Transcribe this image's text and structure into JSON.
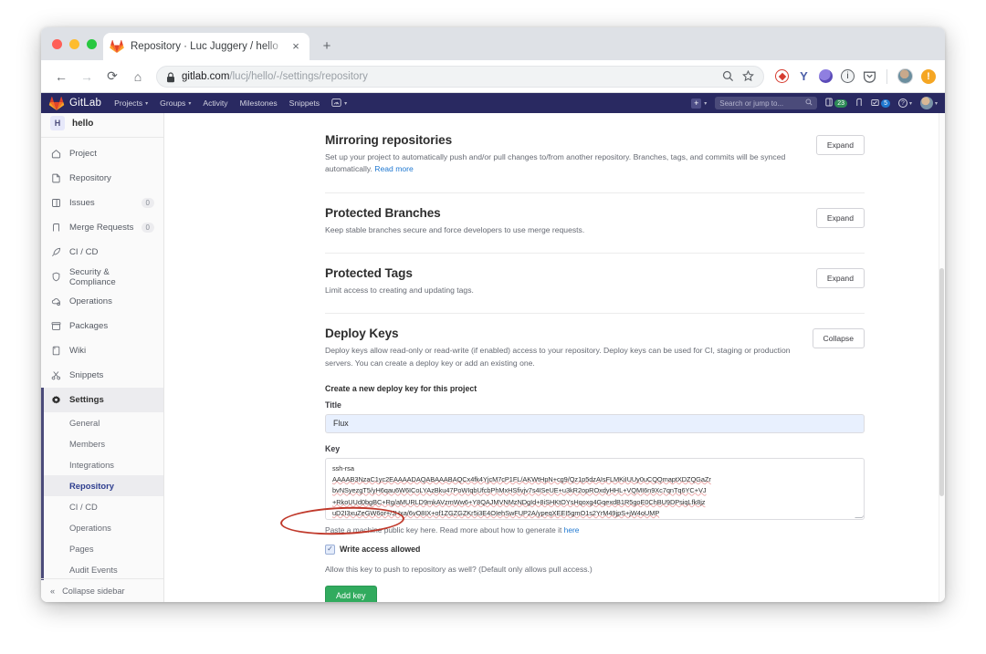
{
  "browser": {
    "tab": {
      "title": "Repository · Luc Juggery / hello",
      "favicon": "gitlab-fox-icon",
      "close": "×"
    },
    "new_tab_label": "+",
    "nav": {
      "back": "←",
      "forward": "→",
      "reload": "⟳",
      "home": "⌂"
    },
    "omnibox": {
      "lock": "lock-icon",
      "domain": "gitlab.com",
      "path": "/lucj/hello/-/settings/repository",
      "search_icon": "magnifier-icon",
      "star_icon": "star-icon"
    },
    "extensions": [
      {
        "name": "lastpass-extension-icon",
        "color": "#d63b2f"
      },
      {
        "name": "vimium-extension-icon",
        "color": "#4b5ea8"
      },
      {
        "name": "globe-extension-icon",
        "color": "#6f63c6"
      },
      {
        "name": "info-extension-icon",
        "color": "#5f6368"
      },
      {
        "name": "pocket-extension-icon",
        "color": "#5f6368"
      }
    ],
    "profile_warning": "!"
  },
  "gitlab": {
    "brand": "GitLab",
    "nav_items": [
      {
        "label": "Projects",
        "caret": true
      },
      {
        "label": "Groups",
        "caret": true
      },
      {
        "label": "Activity",
        "caret": false
      },
      {
        "label": "Milestones",
        "caret": false
      },
      {
        "label": "Snippets",
        "caret": false
      },
      {
        "label": "",
        "caret": true,
        "icon": "help-dashboard-icon"
      }
    ],
    "plus_label": "+",
    "search_placeholder": "Search or jump to...",
    "counters": [
      {
        "icon": "todo-icon",
        "count": "23",
        "color": "#2e8b57"
      },
      {
        "icon": "merge-requests-icon",
        "count": "",
        "color": ""
      },
      {
        "icon": "issues-icon",
        "count": "5",
        "color": "#1f78d1"
      }
    ],
    "help_label": "?",
    "project": {
      "initial": "H",
      "name": "hello"
    },
    "sidebar_items": [
      {
        "label": "Project",
        "icon": "home-icon",
        "count": ""
      },
      {
        "label": "Repository",
        "icon": "document-icon",
        "count": ""
      },
      {
        "label": "Issues",
        "icon": "issues-icon",
        "count": "0"
      },
      {
        "label": "Merge Requests",
        "icon": "merge-icon",
        "count": "0"
      },
      {
        "label": "CI / CD",
        "icon": "rocket-icon",
        "count": ""
      },
      {
        "label": "Security & Compliance",
        "icon": "shield-icon",
        "count": ""
      },
      {
        "label": "Operations",
        "icon": "cloud-gear-icon",
        "count": ""
      },
      {
        "label": "Packages",
        "icon": "package-icon",
        "count": ""
      },
      {
        "label": "Wiki",
        "icon": "book-icon",
        "count": ""
      },
      {
        "label": "Snippets",
        "icon": "scissors-icon",
        "count": ""
      },
      {
        "label": "Settings",
        "icon": "gear-icon",
        "count": "",
        "active": true
      }
    ],
    "settings_subitems": [
      {
        "label": "General"
      },
      {
        "label": "Members"
      },
      {
        "label": "Integrations"
      },
      {
        "label": "Repository",
        "active": true
      },
      {
        "label": "CI / CD"
      },
      {
        "label": "Operations"
      },
      {
        "label": "Pages"
      },
      {
        "label": "Audit Events"
      }
    ],
    "collapse_sidebar": "Collapse sidebar",
    "collapse_icon": "«"
  },
  "sections": [
    {
      "title": "Mirroring repositories",
      "desc": "Set up your project to automatically push and/or pull changes to/from another repository. Branches, tags, and commits will be synced automatically. ",
      "link": "Read more",
      "button": "Expand"
    },
    {
      "title": "Protected Branches",
      "desc": "Keep stable branches secure and force developers to use merge requests.",
      "link": "",
      "button": "Expand"
    },
    {
      "title": "Protected Tags",
      "desc": "Limit access to creating and updating tags.",
      "link": "",
      "button": "Expand"
    }
  ],
  "deploy_keys": {
    "title": "Deploy Keys",
    "desc": "Deploy keys allow read-only or read-write (if enabled) access to your repository. Deploy keys can be used for CI, staging or production servers. You can create a deploy key or add an existing one.",
    "button": "Collapse",
    "form_heading": "Create a new deploy key for this project",
    "title_label": "Title",
    "title_value": "Flux",
    "key_label": "Key",
    "key_lines": [
      "ssh-rsa",
      "AAAAB3NzaC1yc2EAAAADAQABAAABAQCx4fk4YjcM7cP1FL/AKWtHpN+cg9/Qz1p5dzAIsFLMKiIUUy0uCQQmaptXDZQGaZr",
      "bvNSyezgT5/yH6qau6W6ICoLYAzBku47PoWIqbUfcbPhMxHSfivjv7s4ISeUE+u3kR2opROxdyHHL+VQMI6n9Xc7qnTq6YC+VJ",
      "+RkoUUd0bgBC+Rg/aMURLD9mkAVzmWw6+Y8QAJMVNMzNDgId+8iSHKtOYsHqoxg4GqexdB1R5goE0ChBU9DPsiqLfk8jz",
      "uD2I3xuZeGW6or+/JHxa/6vO8IX+of1ZGZGZKr5i3E4OIehSwFUP2A/ypeqXEEI5gmO1s2YrM49jpS+jW4oUMP"
    ],
    "paste_hint": "Paste a machine public key here. Read more about how to generate it ",
    "paste_hint_link": "here",
    "checkbox_label": "Write access allowed",
    "checkbox_checked": true,
    "checkbox_glyph": "✓",
    "allow_desc": "Allow this key to push to repository as well? (Default only allows pull access.)",
    "add_button": "Add key"
  },
  "annotation": {
    "shape": "oval",
    "color": "#c0392b",
    "target": "Write access allowed"
  }
}
